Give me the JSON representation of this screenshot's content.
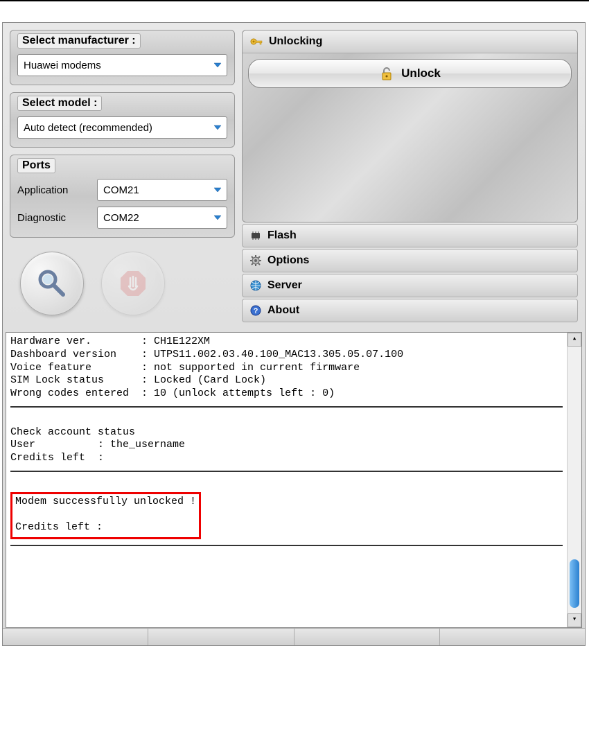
{
  "left": {
    "manufacturer_label": "Select manufacturer :",
    "manufacturer_value": "Huawei modems",
    "model_label": "Select model :",
    "model_value": "Auto detect (recommended)",
    "ports_label": "Ports",
    "app_port_label": "Application",
    "app_port_value": "COM21",
    "diag_port_label": "Diagnostic",
    "diag_port_value": "COM22"
  },
  "right": {
    "unlocking_header": "Unlocking",
    "unlock_btn": "Unlock",
    "flash_header": "Flash",
    "options_header": "Options",
    "server_header": "Server",
    "about_header": "About"
  },
  "log": {
    "l1": "Hardware ver.        : CH1E122XM",
    "l2": "Dashboard version    : UTPS11.002.03.40.100_MAC13.305.05.07.100",
    "l3": "Voice feature        : not supported in current firmware",
    "l4": "SIM Lock status      : Locked (Card Lock)",
    "l5": "Wrong codes entered  : 10 (unlock attempts left : 0)",
    "l6": "Check account status",
    "l7": "User          : the_username",
    "l8": "Credits left  :",
    "h1": "Modem successfully unlocked !",
    "h2": "Credits left :"
  }
}
